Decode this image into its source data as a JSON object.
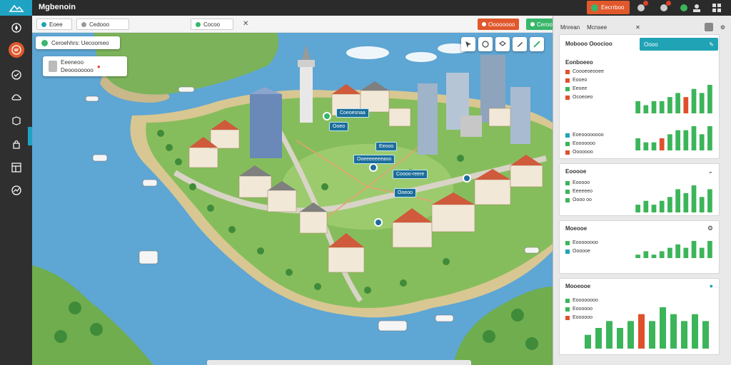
{
  "app": {
    "title": "Mgbenoin",
    "top_action_label": "Eecrrboo"
  },
  "toolbar": {
    "field1": "Eoee",
    "field2": "Cedooo",
    "field3": "Cocoo",
    "button1": "Oooooooo",
    "button2": "Cerooo"
  },
  "map_overlays": {
    "info_card1": "Ceroehhrs: Uecoomeo",
    "info_card2_line1": "Eeeneoo",
    "info_card2_line2": "Deoooooooo",
    "pins": [
      "Coeoesnaa",
      "Ooeo",
      "Eeooo",
      "Ooeeeeeeeaoo",
      "Coooo-reere",
      "Ooeoo"
    ]
  },
  "right_panel": {
    "tab_a": "Mnrean",
    "tab_b": "Mcnsee",
    "teal_button": "Oooo",
    "section_title": "Mobooo Ooocioo",
    "card1": {
      "title": "Eonboeeo",
      "legend": [
        "Coooeoeooee",
        "Eooeo",
        "Eeoee",
        "Ocoeoeo"
      ],
      "legend2": [
        "Eoeoooooooo",
        "Eooooooo",
        "Ooooooo"
      ]
    },
    "card2": {
      "title": "Eooooe",
      "legend": [
        "Eooooo",
        "Eeeeeeo",
        "Oooo oo"
      ]
    },
    "card3": {
      "title": "Moeooe",
      "rows": [
        "Eoooooooo",
        "Oooooe"
      ]
    },
    "card4": {
      "title": "Mooeooe",
      "rows": [
        "Eoooooooo",
        "Eoooooo",
        "Eoooooo"
      ]
    }
  },
  "chart_data": [
    {
      "type": "bar",
      "series": [
        {
          "values": [
            3,
            2,
            3,
            3,
            4,
            5,
            4,
            6,
            5,
            7
          ]
        }
      ]
    },
    {
      "type": "bar",
      "series": [
        {
          "values": [
            3,
            2,
            2,
            3,
            4,
            5,
            5,
            6,
            4,
            6
          ]
        }
      ]
    },
    {
      "type": "bar",
      "series": [
        {
          "values": [
            2,
            3,
            2,
            3,
            4,
            6,
            5,
            7,
            4,
            6
          ]
        }
      ]
    },
    {
      "type": "bar",
      "series": [
        {
          "values": [
            1,
            2,
            1,
            2,
            3,
            4,
            3,
            5,
            3,
            5
          ]
        }
      ]
    },
    {
      "type": "bar",
      "series": [
        {
          "values": [
            2,
            3,
            4,
            3,
            4,
            5,
            4,
            6,
            5,
            4,
            5,
            4
          ]
        }
      ]
    }
  ],
  "colors": {
    "accent_teal": "#1fa3c4",
    "accent_orange": "#e0582c",
    "bar_green": "#3cb55a",
    "bar_red": "#e0502c"
  }
}
